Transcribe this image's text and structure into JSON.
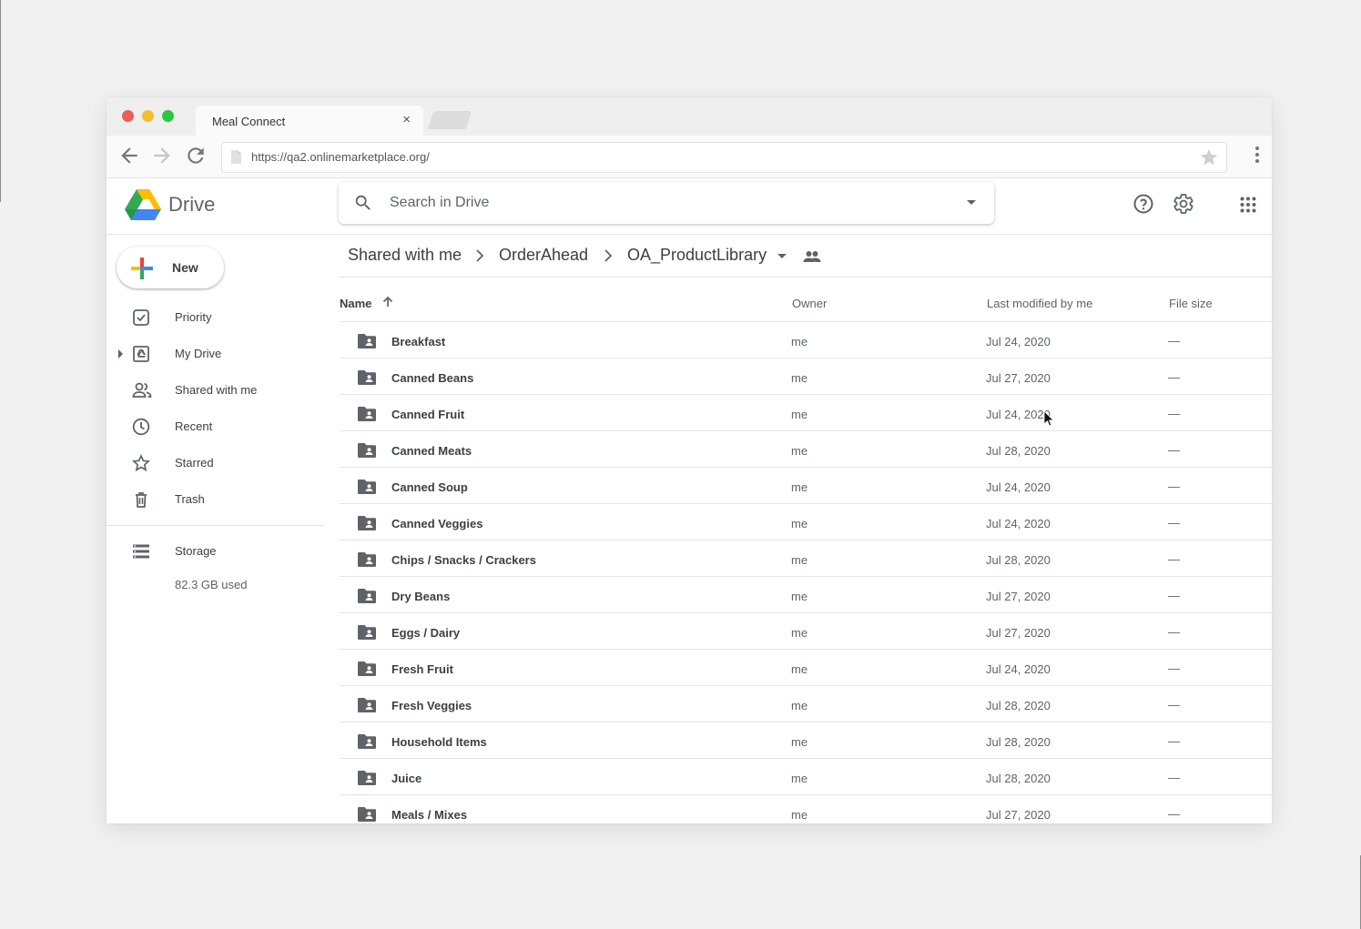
{
  "browser": {
    "tab_title": "Meal Connect",
    "tab_close": "×",
    "url": "https://qa2.onlinemarketplace.org/"
  },
  "drive": {
    "logo_text": "Drive",
    "search_placeholder": "Search in Drive"
  },
  "sidebar": {
    "new_label": "New",
    "items": [
      {
        "label": "Priority",
        "icon": "priority-icon"
      },
      {
        "label": "My Drive",
        "icon": "my-drive-icon"
      },
      {
        "label": "Shared with me",
        "icon": "shared-icon"
      },
      {
        "label": "Recent",
        "icon": "clock-icon"
      },
      {
        "label": "Starred",
        "icon": "star-icon"
      },
      {
        "label": "Trash",
        "icon": "trash-icon"
      }
    ],
    "storage_label": "Storage",
    "storage_used": "82.3 GB used"
  },
  "breadcrumb": [
    "Shared with me",
    "OrderAhead",
    "OA_ProductLibrary"
  ],
  "table": {
    "headers": {
      "name": "Name",
      "owner": "Owner",
      "modified": "Last modified by me",
      "size": "File size"
    },
    "rows": [
      {
        "name": "Breakfast",
        "owner": "me",
        "modified": "Jul 24, 2020",
        "size": "—"
      },
      {
        "name": "Canned Beans",
        "owner": "me",
        "modified": "Jul 27, 2020",
        "size": "—"
      },
      {
        "name": "Canned Fruit",
        "owner": "me",
        "modified": "Jul 24, 2020",
        "size": "—"
      },
      {
        "name": "Canned Meats",
        "owner": "me",
        "modified": "Jul 28, 2020",
        "size": "—"
      },
      {
        "name": "Canned Soup",
        "owner": "me",
        "modified": "Jul 24, 2020",
        "size": "—"
      },
      {
        "name": "Canned Veggies",
        "owner": "me",
        "modified": "Jul 24, 2020",
        "size": "—"
      },
      {
        "name": "Chips / Snacks / Crackers",
        "owner": "me",
        "modified": "Jul 28, 2020",
        "size": "—"
      },
      {
        "name": "Dry Beans",
        "owner": "me",
        "modified": "Jul 27, 2020",
        "size": "—"
      },
      {
        "name": "Eggs / Dairy",
        "owner": "me",
        "modified": "Jul 27, 2020",
        "size": "—"
      },
      {
        "name": "Fresh Fruit",
        "owner": "me",
        "modified": "Jul 24, 2020",
        "size": "—"
      },
      {
        "name": "Fresh Veggies",
        "owner": "me",
        "modified": "Jul 28, 2020",
        "size": "—"
      },
      {
        "name": "Household Items",
        "owner": "me",
        "modified": "Jul 28, 2020",
        "size": "—"
      },
      {
        "name": "Juice",
        "owner": "me",
        "modified": "Jul 28, 2020",
        "size": "—"
      },
      {
        "name": "Meals / Mixes",
        "owner": "me",
        "modified": "Jul 27, 2020",
        "size": "—"
      }
    ]
  },
  "colors": {
    "google_blue": "#4285f4",
    "google_red": "#ea4335",
    "google_yellow": "#fbbc04",
    "google_green": "#34a853",
    "icon_grey": "#5f6368"
  }
}
